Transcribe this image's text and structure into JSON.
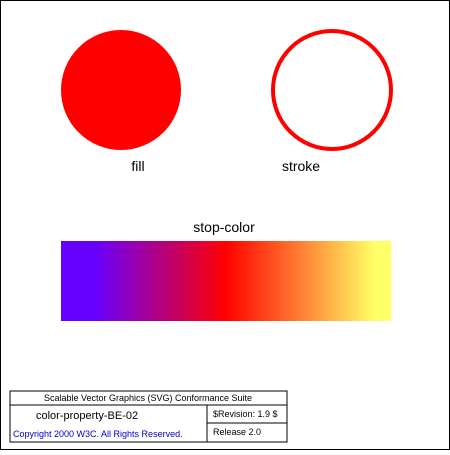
{
  "labels": {
    "fill": "fill",
    "stroke": "stroke",
    "stop_color": "stop-color"
  },
  "colors": {
    "fill_circle": "#FF0000",
    "stroke_circle": "#FF0000",
    "gradient_stop_1": "#6600FF",
    "gradient_stop_2": "#FF0000",
    "gradient_stop_3": "#FFFF66",
    "legend_border": "#000000",
    "copyright_text": "#0000CC"
  },
  "legend": {
    "suite_title": "Scalable Vector Graphics (SVG) Conformance Suite",
    "test_name": "color-property-BE-02",
    "revision": "$Revision: 1.9 $",
    "copyright": "Copyright 2000 W3C. All Rights Reserved.",
    "release": "Release 2.0"
  }
}
